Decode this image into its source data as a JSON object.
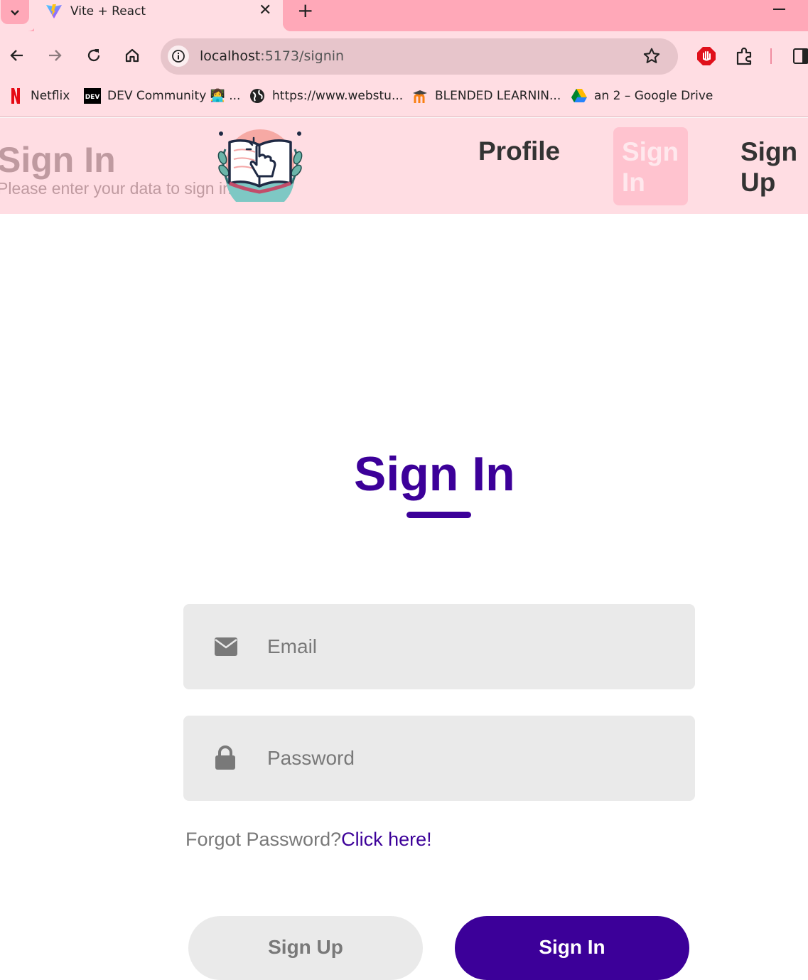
{
  "browser": {
    "tab_title": "Vite + React",
    "url_host": "localhost",
    "url_path": ":5173/signin",
    "bookmarks": [
      {
        "label": "Netflix",
        "icon": "netflix-icon"
      },
      {
        "label": "DEV Community 👩‍💻 ...",
        "icon": "dev-icon"
      },
      {
        "label": "https://www.webstu...",
        "icon": "globe-icon"
      },
      {
        "label": "BLENDED LEARNIN...",
        "icon": "moodle-icon"
      },
      {
        "label": "an 2 – Google Drive",
        "icon": "google-drive-icon"
      }
    ]
  },
  "header": {
    "title": "Sign In",
    "subtitle": "Please enter your data to sign in",
    "nav": {
      "profile": "Profile",
      "signin_line1": "Sign",
      "signin_line2": "In",
      "signup_line1": "Sign",
      "signup_line2": "Up"
    }
  },
  "form": {
    "title": "Sign In",
    "email_placeholder": "Email",
    "password_placeholder": "Password",
    "forgot_text": "Forgot Password?",
    "forgot_link": "Click here!",
    "signup_button": "Sign Up",
    "signin_button": "Sign In"
  },
  "colors": {
    "accent": "#3c0099",
    "header_bg": "#ffdde3",
    "tab_strip": "#ffa8b8",
    "field_bg": "#eaeaea"
  }
}
